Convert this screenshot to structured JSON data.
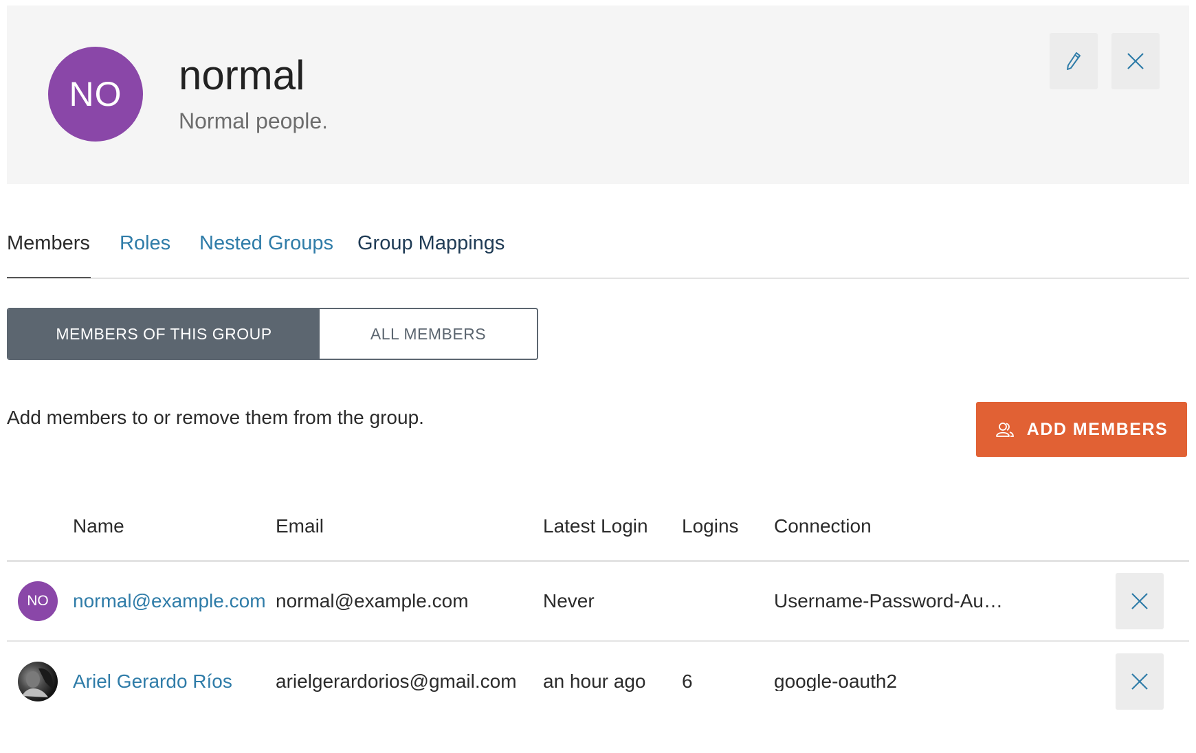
{
  "group": {
    "initials": "NO",
    "name": "normal",
    "description": "Normal people.",
    "avatar_color": "#8a47a8"
  },
  "header_actions": {
    "edit_icon": "pencil-icon",
    "close_icon": "close-icon"
  },
  "tabs": [
    {
      "label": "Members",
      "active": true
    },
    {
      "label": "Roles",
      "active": false
    },
    {
      "label": "Nested Groups",
      "active": false
    },
    {
      "label": "Group Mappings",
      "active": false
    }
  ],
  "segments": {
    "members_of_group": "MEMBERS OF THIS GROUP",
    "all_members": "ALL MEMBERS",
    "selected": "MEMBERS OF THIS GROUP"
  },
  "helper_text": "Add members to or remove them from the group.",
  "add_button": {
    "label": "ADD MEMBERS",
    "icon": "users-icon",
    "color": "#e16134"
  },
  "table": {
    "columns": [
      "Name",
      "Email",
      "Latest Login",
      "Logins",
      "Connection"
    ],
    "rows": [
      {
        "avatar_initials": "NO",
        "avatar_color": "#8a47a8",
        "name": "normal@example.com",
        "email": "normal@example.com",
        "latest_login": "Never",
        "logins": "",
        "connection": "Username-Password-Authentication"
      },
      {
        "avatar_initials": "",
        "avatar_type": "photo",
        "name": "Ariel Gerardo Ríos",
        "email": "arielgerardorios@gmail.com",
        "latest_login": "an hour ago",
        "logins": "6",
        "connection": "google-oauth2"
      }
    ]
  }
}
